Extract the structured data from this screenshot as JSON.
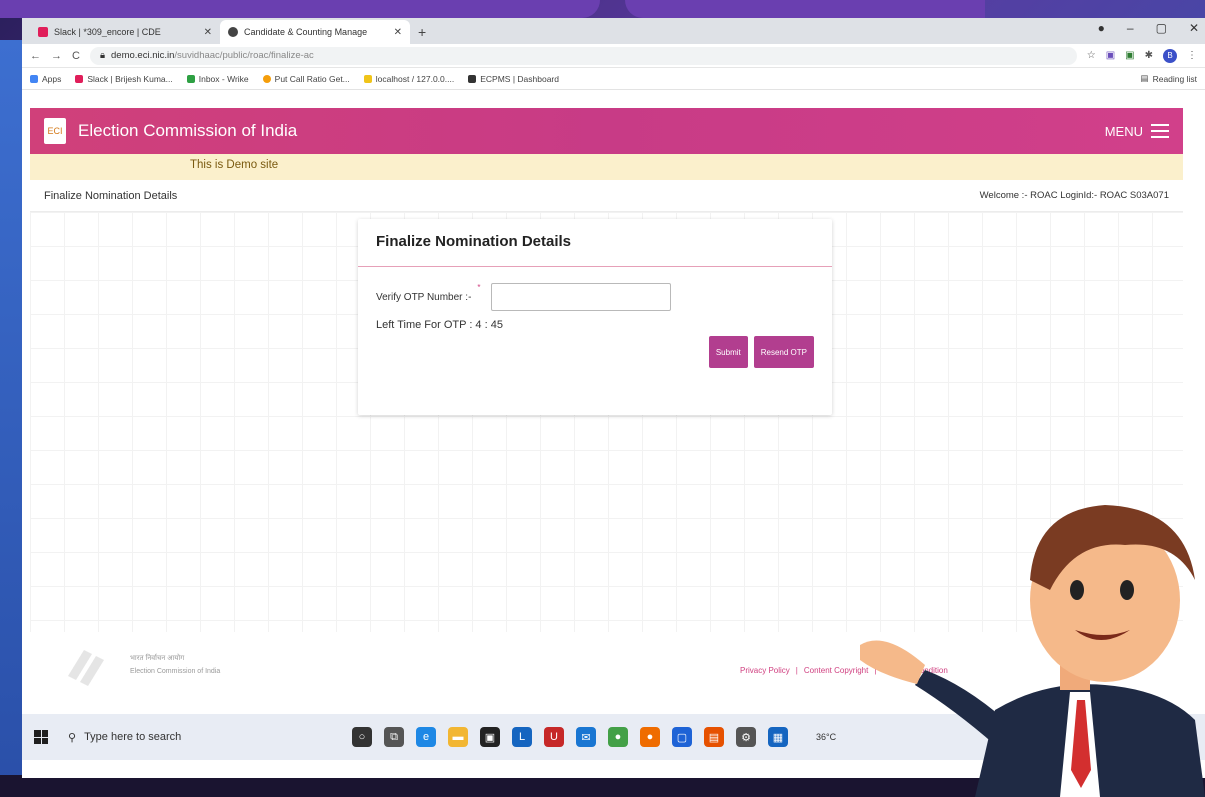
{
  "browser": {
    "tabs": [
      {
        "title": "Slack | *309_encore | CDE",
        "fav_color": "#e01e5a"
      },
      {
        "title": "Candidate & Counting Manage",
        "fav_color": "#444444"
      }
    ],
    "new_tab": "+",
    "address": {
      "host": "demo.eci.nic.in",
      "path": "/suvidhaac/public/roac/finalize-ac"
    },
    "bookmarks": [
      {
        "label": "Apps",
        "color": "#4285f4"
      },
      {
        "label": "Slack | Brijesh Kuma...",
        "color": "#e01e5a"
      },
      {
        "label": "Inbox - Wrike",
        "color": "#2ea043"
      },
      {
        "label": "Put Call Ratio Get...",
        "color": "#f59e0b"
      },
      {
        "label": "localhost / 127.0.0....",
        "color": "#f0c419"
      },
      {
        "label": "ECPMS | Dashboard",
        "color": "#333333"
      }
    ],
    "reading_list": "Reading list",
    "profile_initial": "B"
  },
  "header": {
    "title": "Election Commission of India",
    "menu_label": "MENU",
    "logo_text": "ECI"
  },
  "demo_notice": "This is Demo site",
  "subbar": {
    "page": "Finalize Nomination Details",
    "welcome": "Welcome :- ROAC LoginId:- ROAC S03A071"
  },
  "card": {
    "title": "Finalize Nomination Details",
    "otp_label": "Verify OTP Number :-",
    "required_mark": "*",
    "timer": "Left Time For OTP : 4 : 45",
    "submit_label": "Submit",
    "resend_label": "Resend OTP"
  },
  "footer": {
    "line1": "भारत निर्वाचन आयोग",
    "line2": "Election Commission of India",
    "links": [
      "Privacy Policy",
      "|",
      "Content Copyright",
      "|",
      "Terms & Condition"
    ]
  },
  "taskbar": {
    "search_placeholder": "Type here to search",
    "weather": "36°C",
    "icons": [
      {
        "name": "cortana-icon",
        "color": "#333333",
        "glyph": "○"
      },
      {
        "name": "task-view-icon",
        "color": "#555555",
        "glyph": "⧉"
      },
      {
        "name": "edge-icon",
        "color": "#1e88e5",
        "glyph": "e"
      },
      {
        "name": "folder-icon",
        "color": "#f2b632",
        "glyph": "▬"
      },
      {
        "name": "store-icon",
        "color": "#222222",
        "glyph": "▣"
      },
      {
        "name": "l-app-icon",
        "color": "#1565c0",
        "glyph": "L"
      },
      {
        "name": "mcafee-icon",
        "color": "#c62828",
        "glyph": "U"
      },
      {
        "name": "mail-icon",
        "color": "#1976d2",
        "glyph": "✉"
      },
      {
        "name": "chrome-icon",
        "color": "#43a047",
        "glyph": "●"
      },
      {
        "name": "firefox-icon",
        "color": "#ef6c00",
        "glyph": "●"
      },
      {
        "name": "app-blue-icon",
        "color": "#1e63d6",
        "glyph": "▢"
      },
      {
        "name": "app-orange-icon",
        "color": "#e65100",
        "glyph": "▤"
      },
      {
        "name": "settings-icon",
        "color": "#555555",
        "glyph": "⚙"
      },
      {
        "name": "app-grid-icon",
        "color": "#1565c0",
        "glyph": "▦"
      }
    ]
  },
  "colors": {
    "accent": "#c83b86",
    "button": "#b23e8f",
    "demo_bg": "#fbf0cc"
  }
}
